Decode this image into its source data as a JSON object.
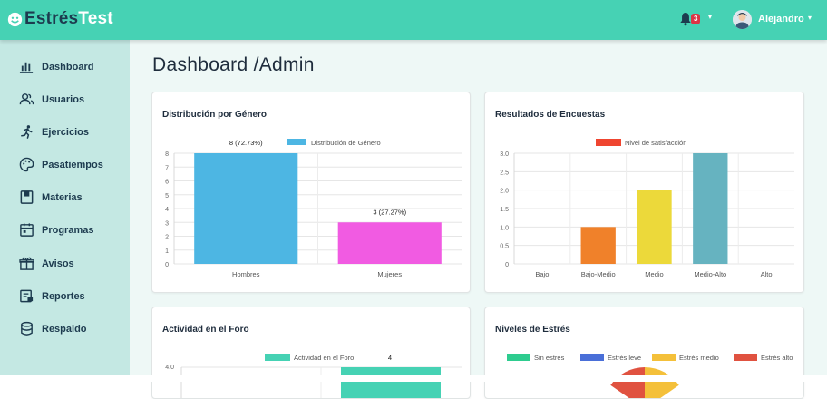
{
  "brand": {
    "part1": "Estrés",
    "part2": "Test"
  },
  "header": {
    "notifications_count": "3",
    "username": "Alejandro"
  },
  "sidebar": {
    "items": [
      {
        "label": "Dashboard",
        "icon": "bar-chart-icon"
      },
      {
        "label": "Usuarios",
        "icon": "users-icon"
      },
      {
        "label": "Ejercicios",
        "icon": "running-icon"
      },
      {
        "label": "Pasatiempos",
        "icon": "palette-icon"
      },
      {
        "label": "Materias",
        "icon": "book-icon"
      },
      {
        "label": "Programas",
        "icon": "calendar-icon"
      },
      {
        "label": "Avisos",
        "icon": "gift-icon"
      },
      {
        "label": "Reportes",
        "icon": "report-icon"
      },
      {
        "label": "Respaldo",
        "icon": "database-icon"
      }
    ]
  },
  "page": {
    "title": "Dashboard /Admin"
  },
  "cards": {
    "gender": {
      "title": "Distribución por Género"
    },
    "surveys": {
      "title": "Resultados de Encuestas"
    },
    "forum": {
      "title": "Actividad en el Foro"
    },
    "stress": {
      "title": "Niveles de Estrés"
    }
  },
  "chart_data": [
    {
      "type": "bar",
      "title": "Distribución por Género",
      "categories": [
        "Hombres",
        "Mujeres"
      ],
      "series": [
        {
          "name": "Distribución de Género",
          "values": [
            8,
            3
          ],
          "colors": [
            "#4db6e3",
            "#f15be2"
          ]
        }
      ],
      "data_labels": [
        "8 (72.73%)",
        "3 (27.27%)"
      ],
      "ylim": [
        0,
        8
      ],
      "yticks": [
        0,
        1,
        2,
        3,
        4,
        5,
        6,
        7,
        8
      ],
      "legend": "top",
      "grid": true
    },
    {
      "type": "bar",
      "title": "Resultados de Encuestas",
      "categories": [
        "Bajo",
        "Bajo-Medio",
        "Medio",
        "Medio-Alto",
        "Alto"
      ],
      "series": [
        {
          "name": "Nivel de satisfacción",
          "values": [
            0,
            1,
            2,
            3,
            0
          ],
          "colors": [
            "#e53935",
            "#f0812a",
            "#ecd93a",
            "#66b3c0",
            "#999999"
          ]
        }
      ],
      "legend_color": "#ef4530",
      "ylim": [
        0,
        3
      ],
      "yticks": [
        "0",
        "0.5",
        "1.0",
        "1.5",
        "2.0",
        "2.5",
        "3.0"
      ],
      "legend": "top",
      "grid": true
    },
    {
      "type": "bar",
      "title": "Actividad en el Foro",
      "series": [
        {
          "name": "Actividad en el Foro",
          "values": [
            4
          ],
          "colors": [
            "#46d2b4"
          ]
        }
      ],
      "data_labels": [
        "4"
      ],
      "ylim": [
        0,
        4
      ],
      "yticks": [
        "4.0"
      ],
      "legend": "top",
      "grid": true
    },
    {
      "type": "pie",
      "title": "Niveles de Estrés",
      "series": [
        {
          "name": "Sin estrés",
          "color": "#2ecc8f"
        },
        {
          "name": "Estrés leve",
          "color": "#4a6fd8"
        },
        {
          "name": "Estrés medio",
          "color": "#f4c03a"
        },
        {
          "name": "Estrés alto",
          "color": "#e05240"
        }
      ],
      "legend": "top"
    }
  ]
}
